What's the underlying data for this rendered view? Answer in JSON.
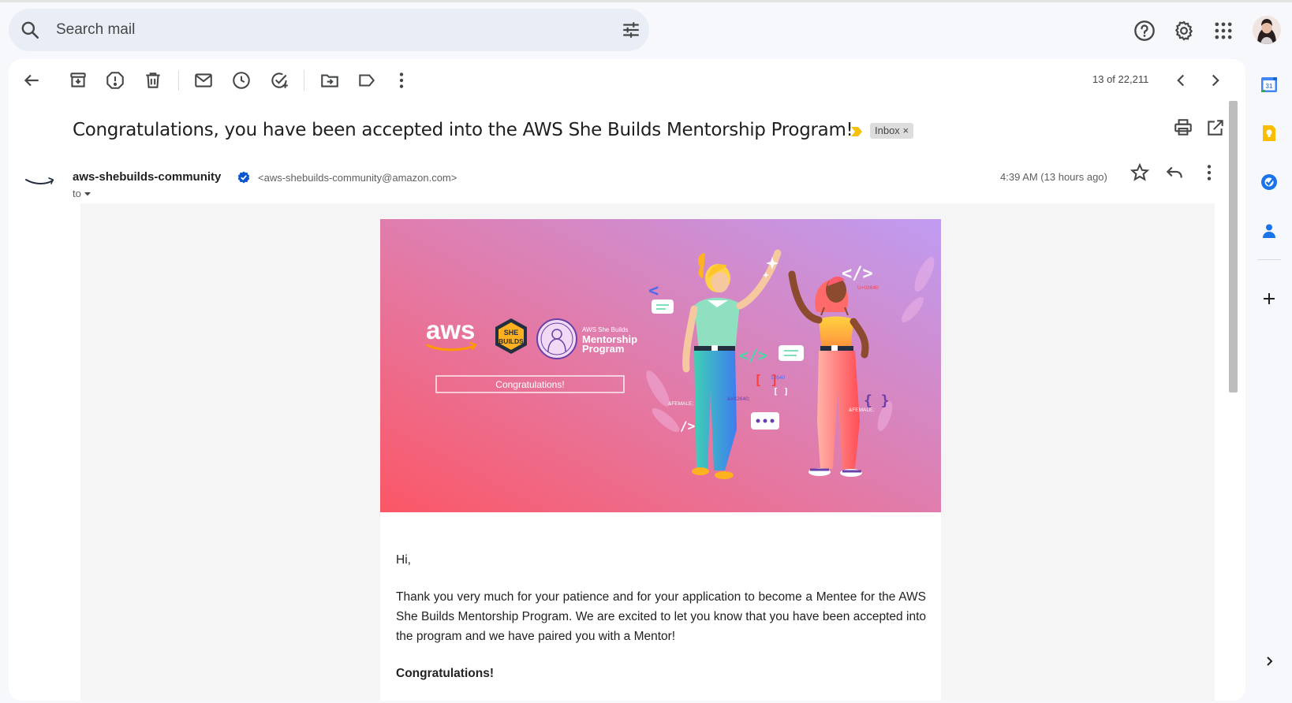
{
  "search": {
    "placeholder": "Search mail"
  },
  "toolbar": {
    "pager": "13 of 22,211"
  },
  "message": {
    "subject": "Congratulations, you have been accepted into the AWS She Builds Mentorship Program!",
    "label": "Inbox",
    "label_remove": "×",
    "sender_name": "aws-shebuilds-community",
    "sender_email": "<aws-shebuilds-community@amazon.com>",
    "to_label": "to",
    "timestamp": "4:39 AM (13 hours ago)"
  },
  "banner": {
    "aws_wordmark": "aws",
    "badge_line1": "SHE",
    "badge_line2": "BUILDS",
    "program_small": "AWS She Builds",
    "program_line1": "Mentorship",
    "program_line2": "Program",
    "congrats_button": "Congratulations!",
    "tag_female1": "&FEMALE;",
    "tag_female2": "&FEMALE;",
    "tag_hex": "&#X2640;",
    "tag_u": "U+02640",
    "tag_num": "12640"
  },
  "body": {
    "greeting": "Hi,",
    "paragraph1": "Thank you very much for your patience and for your application to become a Mentee for the AWS She Builds Mentorship Program. We are excited to let you know that you have been accepted into the program and we have paired you with a Mentor!",
    "congrats": "Congratulations!"
  },
  "colors": {
    "accent_blue": "#0b57d0",
    "banner_pink": "#f05a78",
    "banner_purple": "#c49ef0",
    "aws_orange": "#ff9900"
  }
}
